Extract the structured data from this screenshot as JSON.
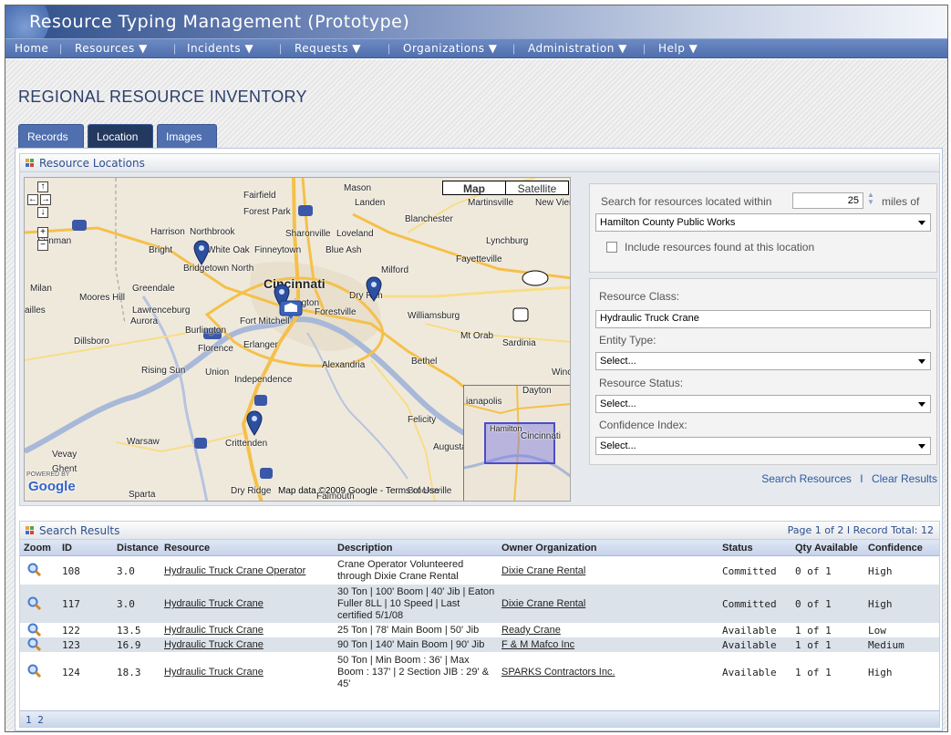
{
  "app": {
    "title": "Resource Typing Management (Prototype)"
  },
  "nav": [
    {
      "label": "Home"
    },
    {
      "label": "Resources ▼"
    },
    {
      "label": "Incidents ▼"
    },
    {
      "label": "Requests ▼"
    },
    {
      "label": "Organizations ▼"
    },
    {
      "label": "Administration ▼"
    },
    {
      "label": "Help ▼"
    }
  ],
  "page": {
    "title": "REGIONAL RESOURCE INVENTORY"
  },
  "tabs": [
    {
      "label": "Records"
    },
    {
      "label": "Location"
    },
    {
      "label": "Images"
    }
  ],
  "locations_panel": {
    "title": "Resource Locations"
  },
  "map": {
    "types": [
      "Map",
      "Satellite"
    ],
    "active_type": "Map",
    "controls": {
      "up": "↑",
      "left": "←",
      "right": "→",
      "down": "↓",
      "zoom_in": "+",
      "zoom_out": "−"
    },
    "labels": [
      "Fairfield",
      "Mason",
      "Landen",
      "Martinsville",
      "New Vien",
      "Forest Park",
      "Blanchester",
      "Harrison",
      "Northbrook",
      "Sharonville",
      "Loveland",
      "Sunman",
      "Bright",
      "White Oak",
      "Finneytown",
      "Blue Ash",
      "Lynchburg",
      "Fayetteville",
      "Bridgetown North",
      "Milford",
      "Cincinnati",
      "Milan",
      "Moores Hill",
      "Greendale",
      "Covington",
      "Dry Run",
      "Lawrenceburg",
      "Forestville",
      "Williamsburg",
      "Aurora",
      "Fort Mitchell",
      "ailles",
      "Burlington",
      "Mt Orab",
      "Sardinia",
      "Dillsboro",
      "Florence",
      "Erlanger",
      "Bethel",
      "Rising Sun",
      "Union",
      "Alexandria",
      "Independence",
      "Felicity",
      "Warsaw",
      "Crittenden",
      "Vevay",
      "Ghent",
      "Sparta",
      "Dry Ridge",
      "Falmouth",
      "Brooksville",
      "Augusta",
      "Winc"
    ],
    "attribution": "Map data ©2009 Google - Terms of Use",
    "powered_by": "POWERED BY",
    "google": "Google",
    "overview_labels": [
      "Dayton",
      "ianapolis",
      "Hamilton",
      "Cincinnati"
    ]
  },
  "search": {
    "within_label": "Search for resources located within",
    "miles_value": "25",
    "miles_of_label": "miles of",
    "location_value": "Hamilton County Public Works",
    "include_label": "Include resources found at this location"
  },
  "filters": {
    "resource_class_label": "Resource Class:",
    "resource_class_value": "Hydraulic Truck Crane",
    "entity_type_label": "Entity Type:",
    "entity_type_value": "Select...",
    "resource_status_label": "Resource Status:",
    "resource_status_value": "Select...",
    "confidence_label": "Confidence Index:",
    "confidence_value": "Select..."
  },
  "actions": {
    "search": "Search Resources",
    "sep": "I",
    "clear": "Clear Results"
  },
  "results": {
    "title": "Search Results",
    "pager": "Page 1 of 2  I  Record Total: 12",
    "columns": {
      "zoom": "Zoom",
      "id": "ID",
      "distance": "Distance",
      "resource": "Resource",
      "description": "Description",
      "owner": "Owner Organization",
      "status": "Status",
      "qty": "Qty Available",
      "confidence": "Confidence"
    },
    "rows": [
      {
        "id": "108",
        "distance": "3.0",
        "resource": "Hydraulic Truck Crane Operator",
        "desc1": "Crane Operator Volunteered",
        "desc2": "through Dixie Crane Rental",
        "desc3": "",
        "desc4": "",
        "owner": "Dixie Crane Rental",
        "status": "Committed",
        "qty": "0 of 1",
        "confidence": "High"
      },
      {
        "id": "117",
        "distance": "3.0",
        "resource": "Hydraulic Truck Crane",
        "desc1": "30 Ton | 100' Boom | 40' Jib | Eaton",
        "desc2": "Fuller 8LL | 10 Speed | Last",
        "desc3": "certified 5/1/08",
        "desc4": "",
        "owner": "Dixie Crane Rental",
        "status": "Committed",
        "qty": "0 of 1",
        "confidence": "High"
      },
      {
        "id": "122",
        "distance": "13.5",
        "resource": "Hydraulic Truck Crane",
        "desc1": "25 Ton | 78' Main Boom | 50' Jib",
        "desc2": "",
        "desc3": "",
        "desc4": "",
        "owner": "Ready Crane",
        "status": "Available",
        "qty": "1 of 1",
        "confidence": "Low"
      },
      {
        "id": "123",
        "distance": "16.9",
        "resource": "Hydraulic Truck Crane",
        "desc1": "90 Ton | 140' Main Boom | 90' Jib",
        "desc2": "",
        "desc3": "",
        "desc4": "",
        "owner": "F & M Mafco Inc",
        "status": "Available",
        "qty": "1 of 1",
        "confidence": "Medium"
      },
      {
        "id": "124",
        "distance": "18.3",
        "resource": "Hydraulic Truck Crane",
        "desc1": "50 Ton | Min Boom : 36' | Max",
        "desc2": "Boom : 137' | 2 Section JIB : 29' &",
        "desc3": "45'",
        "desc4": "",
        "owner": "SPARKS Contractors Inc.",
        "status": "Available",
        "qty": "1 of 1",
        "confidence": "High"
      }
    ],
    "pages": "1 2"
  },
  "colors": {
    "nav": "#4f6fae",
    "active_tab": "#24395f",
    "alt_row": "#dbe2ea"
  }
}
